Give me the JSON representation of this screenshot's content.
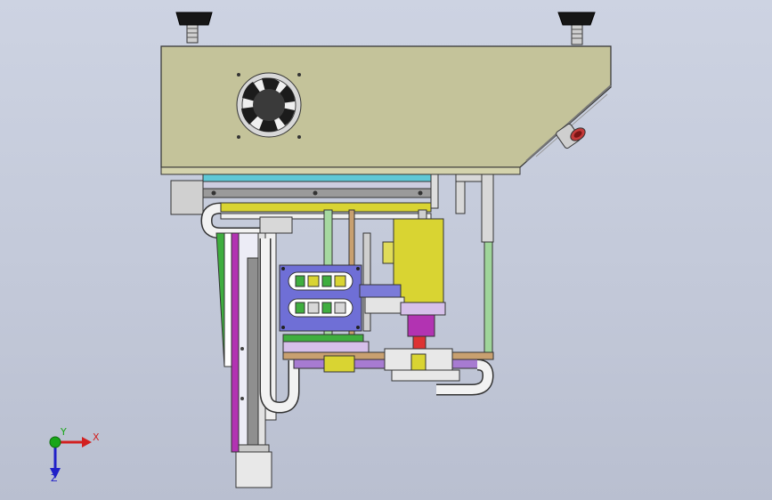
{
  "viewport": {
    "background_top": "#cdd3e2",
    "background_bottom": "#b9bfd0"
  },
  "colors": {
    "housing": "#c4c39a",
    "outline": "#333333",
    "rail_purple": "#a77bd1",
    "rail_magenta": "#b233b2",
    "rail_green": "#3fae3f",
    "cylinder_yellow": "#d9d432",
    "panel_blue": "#6f6fd6",
    "cable_white": "#f2f2f2",
    "tube_pale_green": "#a6d9a0",
    "gray_steel": "#9a9a9a"
  },
  "triad": {
    "x_label": "X",
    "y_label": "Y",
    "z_label": "Z",
    "x_color": "#d22020",
    "y_color": "#19a619",
    "z_color": "#2020c8"
  }
}
